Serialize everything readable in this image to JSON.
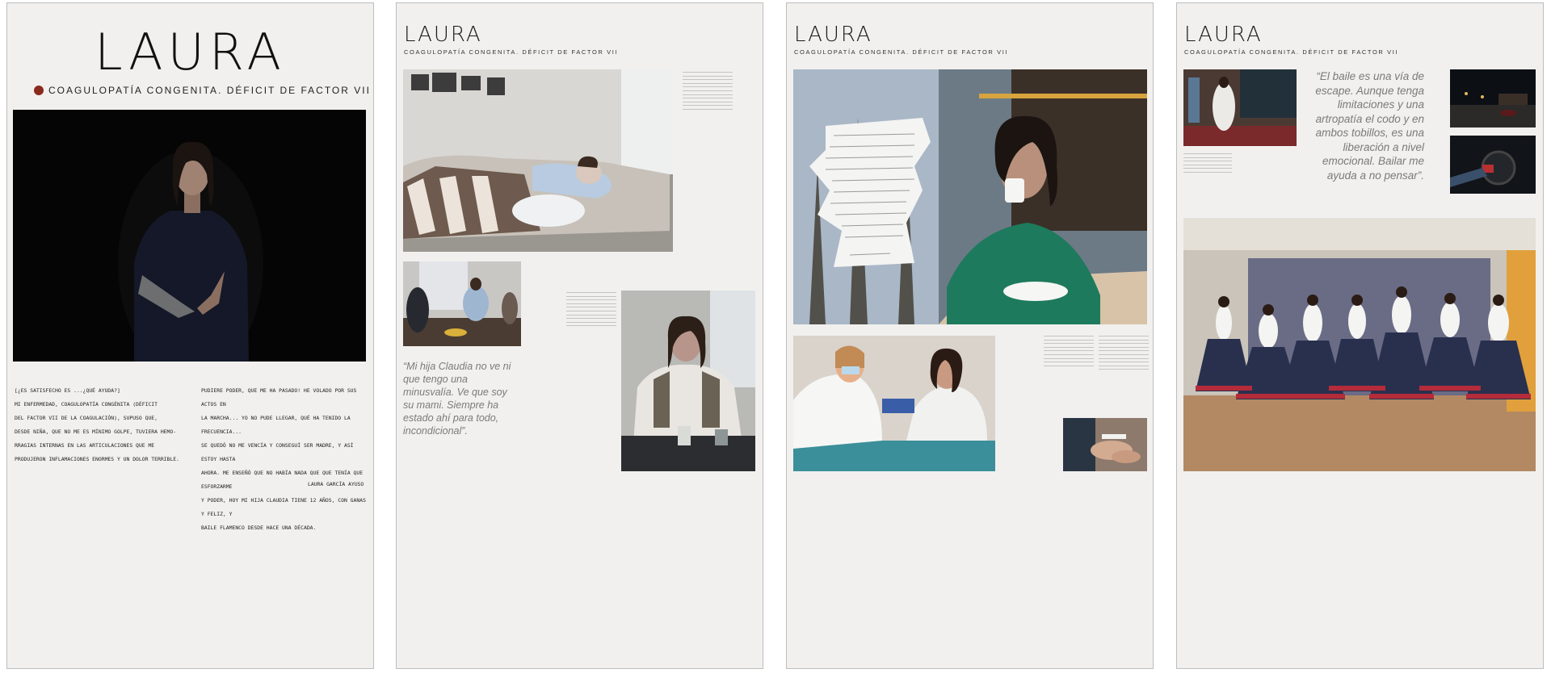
{
  "panels": {
    "p1": {
      "title": "LAURA",
      "subtitle": "COAGULOPATÍA CONGENITA. DÉFICIT DE FACTOR VII",
      "handwritten_left": "[¿ES SATISFECHO ES ...¿QUÉ AYUDA?]\nMI ENFERMEDAD, COAGULOPATÍA CONGÉNITA (DÉFICIT\nDEL FACTOR VII DE LA COAGULACIÓN), SUPUSO QUE,\nDESDE NIÑA, QUE NO ME ES MÍNIMO GOLPE, TUVIERA HEMO-\nRRAGIAS INTERNAS EN LAS ARTICULACIONES QUE ME\nPRODUJERON INFLAMACIONES ENORMES Y UN DOLOR TERRIBLE.",
      "handwritten_right": "PUDIERE PODER, QUE ME HA PASADO! HE VOLADO POR SUS ACTOS EN\nLA MARCHA... YO NO PUDE LLEGAR, QUÉ HA TENIDO LA FRECUENCIA...\nSE QUEDÓ NO ME VENCÍA Y CONSEGUÍ SER MADRE, Y ASÍ ESTOY HASTA\nAHORA. ME ENSEÑÓ QUE NO HABÍA NADA QUE QUE TENÍA QUE ESFORZARME\nY PODER, HOY MI HIJA CLAUDIA TIENE 12 AÑOS, CON GANAS Y FELIZ, Y\nBAILE FLAMENCO DESDE HACE UNA DÉCADA.",
      "signature": "LAURA GARCÍA AYUSO"
    },
    "p2": {
      "title": "LAURA",
      "subtitle": "COAGULOPATÍA CONGENITA. DÉFICIT DE FACTOR VII",
      "quote": "“Mi hija Claudia no ve ni que tengo una minusvalía. Ve que soy su mami. Siempre ha estado ahí para todo, incondicional”."
    },
    "p3": {
      "title": "LAURA",
      "subtitle": "COAGULOPATÍA CONGENITA. DÉFICIT DE FACTOR VII"
    },
    "p4": {
      "title": "LAURA",
      "subtitle": "COAGULOPATÍA CONGENITA. DÉFICIT DE FACTOR VII",
      "quote": "“El baile es una vía de escape. Aunque tenga limitaciones y una artropatía el codo y en ambos tobillos, es una liberación a nivel emocional. Bailar me ayuda a no pensar”."
    }
  },
  "colors": {
    "panel_bg": "#f1f0ee",
    "accent_dot": "#8a2a1c",
    "quote_text": "#7a7a7a"
  }
}
